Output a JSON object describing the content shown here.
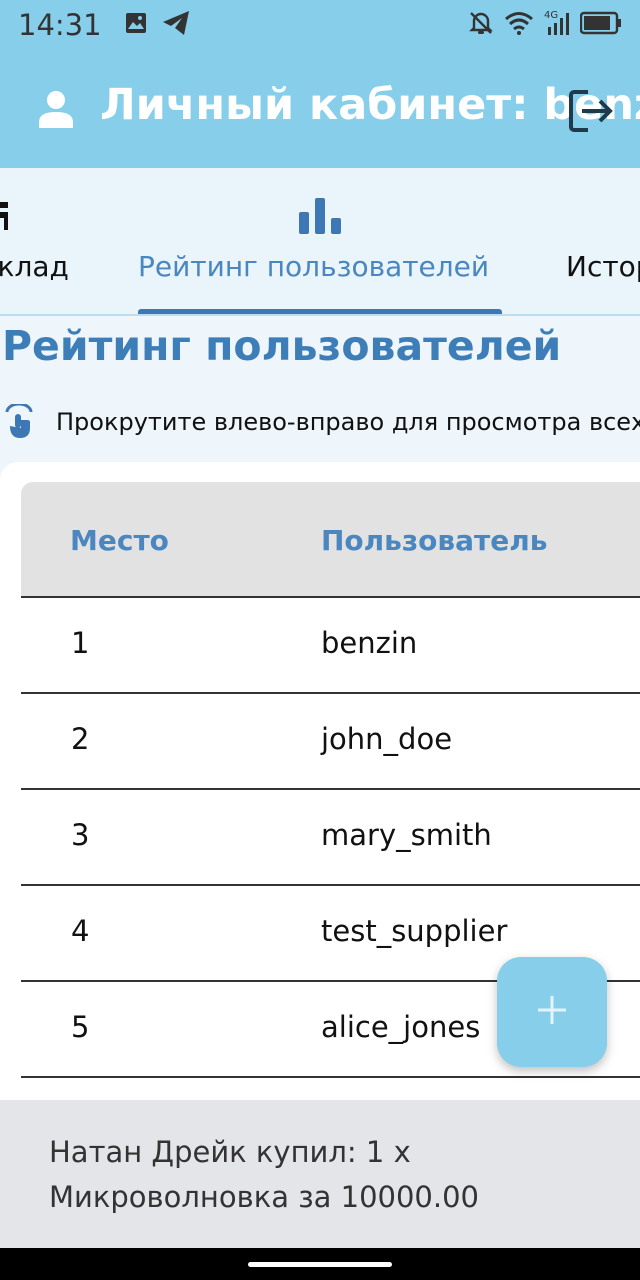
{
  "status_bar": {
    "time": "14:31",
    "icons": [
      "gallery-icon",
      "telegram-icon",
      "bell-off-icon",
      "wifi-icon",
      "cellular-4g-icon",
      "battery-icon"
    ],
    "network_label": "4G"
  },
  "app_bar": {
    "title": "Личный кабинет: benzin",
    "icons": [
      "person-icon",
      "logout-icon"
    ],
    "background": "#87ceeb"
  },
  "tabs": [
    {
      "label": "Склад",
      "icon": "inventory-icon",
      "active": false
    },
    {
      "label": "Рейтинг пользователей",
      "icon": "bar-chart-icon",
      "active": true
    },
    {
      "label": "История",
      "icon": "history-icon",
      "active": false
    }
  ],
  "section": {
    "title": "Рейтинг пользователей",
    "scroll_hint": "Прокрутите влево-вправо для просмотра всех столбцов"
  },
  "table": {
    "columns": [
      "Место",
      "Пользователь"
    ],
    "rows": [
      {
        "rank": "1",
        "user": "benzin"
      },
      {
        "rank": "2",
        "user": "john_doe"
      },
      {
        "rank": "3",
        "user": "mary_smith"
      },
      {
        "rank": "4",
        "user": "test_supplier"
      },
      {
        "rank": "5",
        "user": "alice_jones"
      }
    ]
  },
  "fab": {
    "icon": "plus-icon"
  },
  "snackbar": {
    "message": "Натан Дрейк купил: 1 х Микроволновка за 10000.00"
  },
  "colors": {
    "accent": "#87ceeb",
    "primary_text": "#3d7eb8",
    "tab_indicator": "#3d78b5"
  }
}
